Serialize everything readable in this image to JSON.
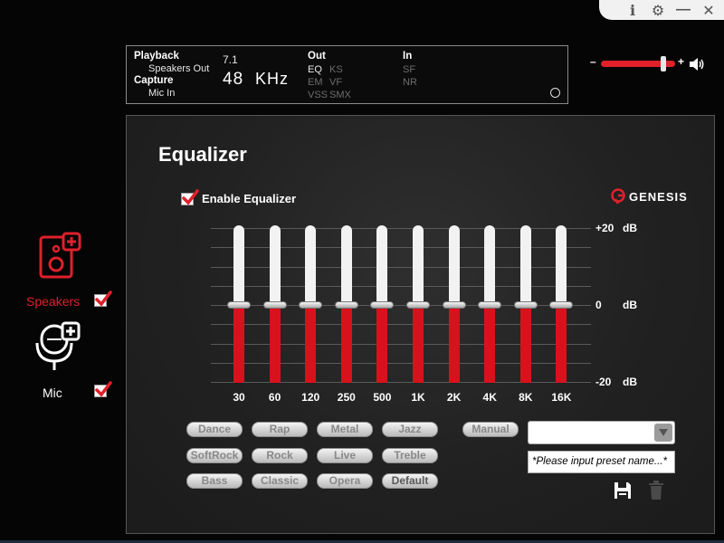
{
  "window_controls": {
    "info": "i",
    "settings": "⚙",
    "minimize": "—",
    "close": "✕"
  },
  "info_panel": {
    "playback_title": "Playback",
    "playback_device": "Speakers Out",
    "capture_title": "Capture",
    "capture_device": "Mic In",
    "channels": "7.1",
    "sample_rate": "48",
    "sample_unit": "KHz",
    "out_title": "Out",
    "out_eq": "EQ",
    "out_ks": "KS",
    "out_em": "EM",
    "out_vf": "VF",
    "out_vss": "VSS",
    "out_smx": "SMX",
    "in_title": "In",
    "in_sf": "SF",
    "in_nr": "NR"
  },
  "volume": {
    "minus": "–",
    "plus": "+",
    "level": 0.82
  },
  "devices": {
    "speakers_label": "Speakers",
    "mic_label": "Mic"
  },
  "equalizer": {
    "title": "Equalizer",
    "enable_label": "Enable Equalizer",
    "brand": "GENESIS",
    "db_top": "+20",
    "db_mid": "0",
    "db_bottom": "-20",
    "db_unit": "dB",
    "bands": [
      {
        "freq": "30",
        "gain": 0
      },
      {
        "freq": "60",
        "gain": 0
      },
      {
        "freq": "120",
        "gain": 0
      },
      {
        "freq": "250",
        "gain": 0
      },
      {
        "freq": "500",
        "gain": 0
      },
      {
        "freq": "1K",
        "gain": 0
      },
      {
        "freq": "2K",
        "gain": 0
      },
      {
        "freq": "4K",
        "gain": 0
      },
      {
        "freq": "8K",
        "gain": 0
      },
      {
        "freq": "16K",
        "gain": 0
      }
    ],
    "presets": [
      [
        "Dance",
        "Rap",
        "Metal",
        "Jazz"
      ],
      [
        "SoftRock",
        "Rock",
        "Live",
        "Treble"
      ],
      [
        "Bass",
        "Classic",
        "Opera",
        "Default"
      ]
    ],
    "manual_label": "Manual",
    "preset_name_placeholder": "*Please input preset name...*"
  },
  "colors": {
    "accent": "#d8121d",
    "panel": "#222222"
  }
}
